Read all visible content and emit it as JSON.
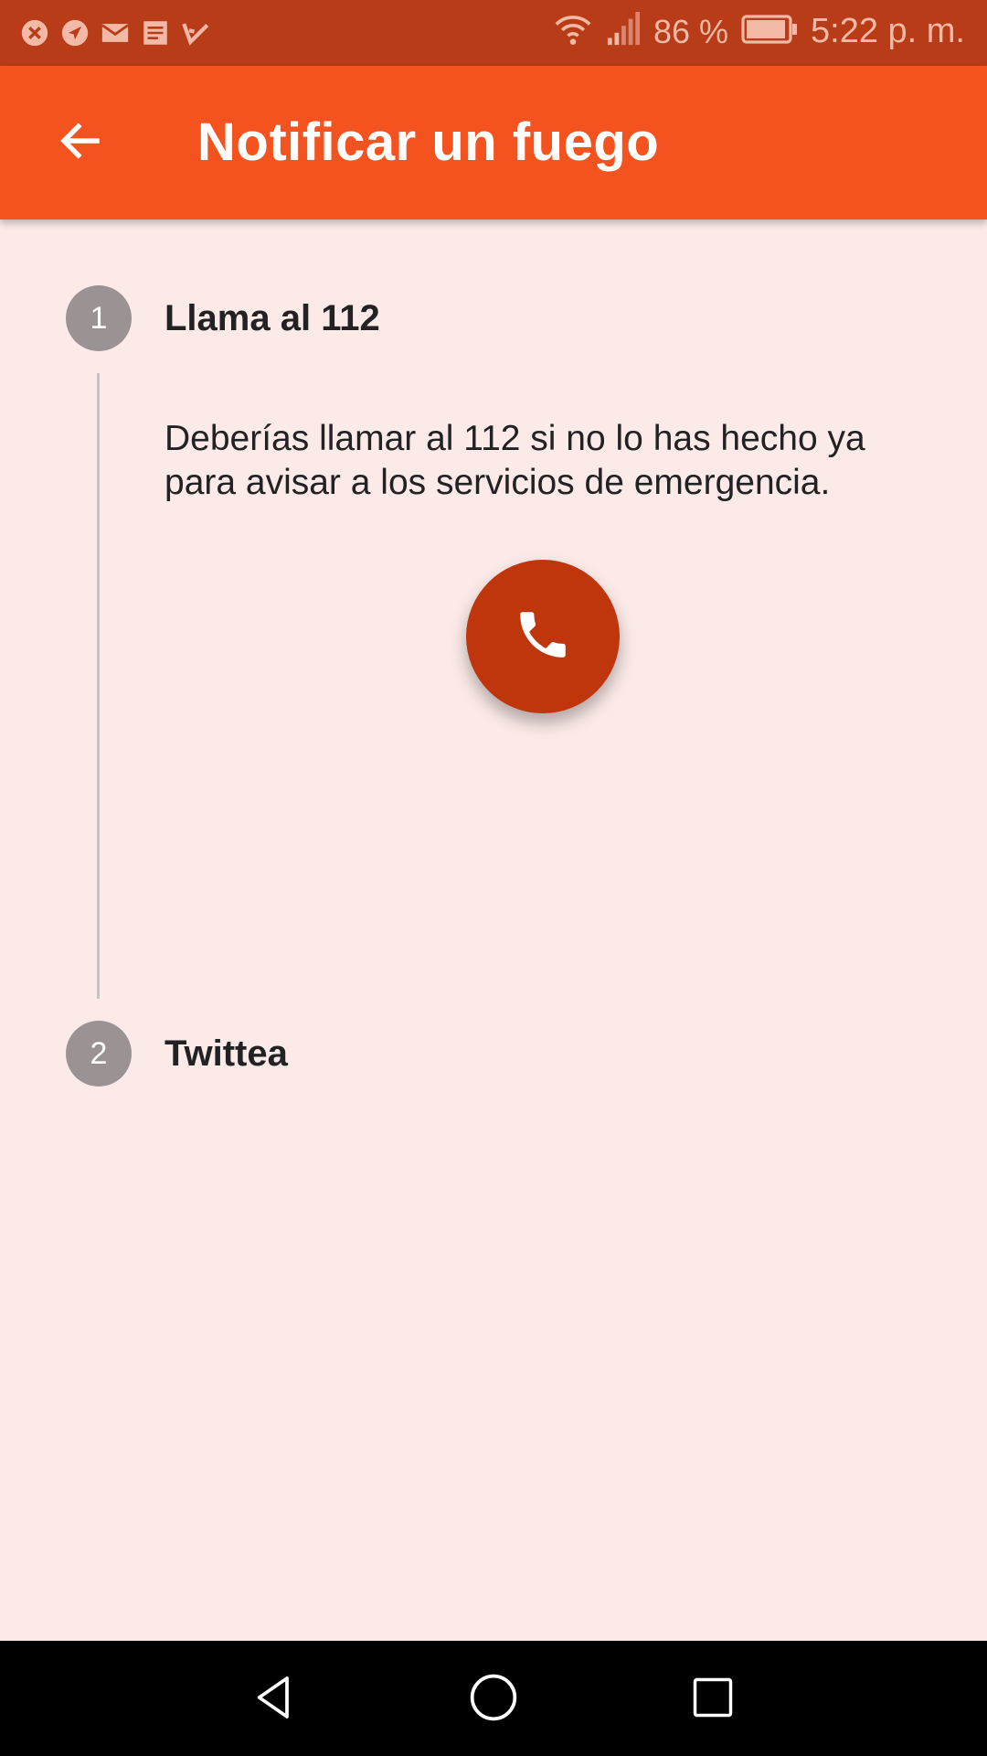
{
  "status_bar": {
    "battery_percent": "86 %",
    "time": "5:22 p. m.",
    "notification_icons": [
      "close-circle-icon",
      "navigation-icon",
      "mail-icon",
      "news-icon",
      "check-icon"
    ],
    "indicator_icons": [
      "wifi-icon",
      "signal-icon",
      "battery-icon"
    ]
  },
  "app_bar": {
    "title": "Notificar un fuego",
    "back_icon": "arrow-back-icon"
  },
  "steps": [
    {
      "number": "1",
      "title": "Llama al 112",
      "description": "Deberías llamar al 112 si no lo has hecho ya para avisar a los servicios de emergencia.",
      "action_icon": "phone-icon"
    },
    {
      "number": "2",
      "title": "Twittea"
    }
  ],
  "nav_bar": {
    "buttons": [
      "back-triangle-icon",
      "home-circle-icon",
      "recents-square-icon"
    ]
  },
  "colors": {
    "status_bar": "#b83c17",
    "app_bar": "#f4531f",
    "background": "#fbeae8",
    "fab": "#bf360c",
    "step_circle": "#9b9393"
  }
}
